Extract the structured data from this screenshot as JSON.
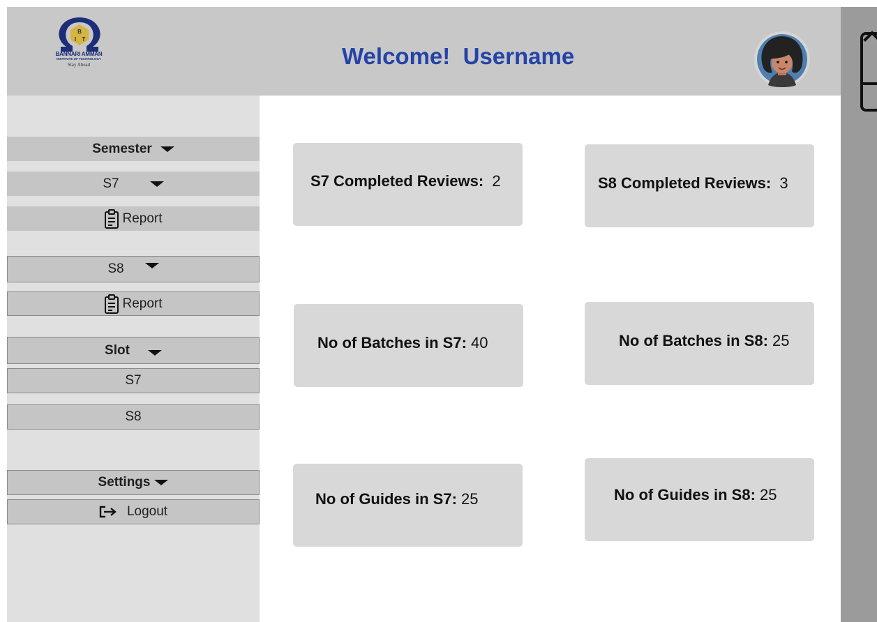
{
  "colors": {
    "header_bg": "#c8c8c8",
    "sidebar_bg": "#e0e0e0",
    "sidebar_row_bg": "#c5c5c5",
    "card_bg": "#d8d8d8",
    "welcome_text": "#2443a8",
    "right_rail_bg": "#9b9b9b"
  },
  "header": {
    "logo": {
      "name": "BANNARI AMMAN",
      "subtitle": "INSTITUTE OF TECHNOLOGY",
      "tagline": "Stay Ahead"
    },
    "welcome": "Welcome!",
    "username": "Username",
    "avatar_icon": "user-avatar"
  },
  "sidebar": {
    "semester_label": "Semester",
    "s7_label": "S7",
    "s7_report_label": "Report",
    "s8_label": "S8",
    "s8_report_label": "Report",
    "slot_label": "Slot",
    "slot_s7": "S7",
    "slot_s8": "S8",
    "settings_label": "Settings",
    "logout_label": "Logout",
    "icons": {
      "dropdown": "caret-down-icon",
      "report": "clipboard-icon",
      "logout": "logout-icon"
    }
  },
  "cards": [
    {
      "label": "S7 Completed Reviews:",
      "value": "2"
    },
    {
      "label": "S8 Completed Reviews:",
      "value": "3"
    },
    {
      "label": "No of Batches in S7:",
      "value": "40"
    },
    {
      "label": "No of Batches in S8:",
      "value": "25"
    },
    {
      "label": "No of Guides in S7:",
      "value": "25"
    },
    {
      "label": "No of Guides in S8:",
      "value": "25"
    }
  ]
}
